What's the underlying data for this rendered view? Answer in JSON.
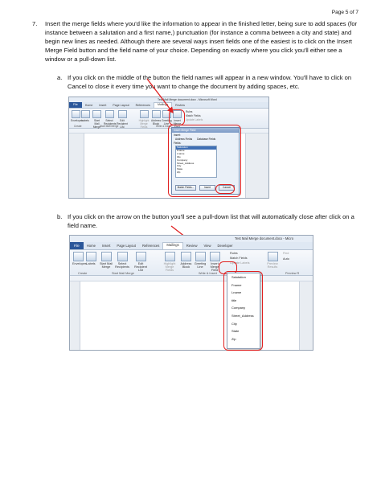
{
  "page_number": "Page 5 of 7",
  "step": {
    "number": "7.",
    "text": "Insert the merge fields where you'd like the information to appear in the finished letter, being sure to add spaces (for instance between a salutation and a first name,) punctuation (for instance a comma between a city and state) and begin new lines as needed.  Although there are several ways insert fields one of the easiest is to click on the Insert Merge Field button and the field name of your choice.  Depending on exactly where you click you'll either see a window or a pull-down list."
  },
  "sub_a": {
    "letter": "a.",
    "text": "If you click on the middle of the button the field names will appear in a new window.  You'll have to click on Cancel to close it every time you want to change the document by adding spaces, etc."
  },
  "sub_b": {
    "letter": "b.",
    "text": "If you click on the arrow on the button you'll see a pull-down list that will automatically close after click on a field name."
  },
  "shot1": {
    "title": "Test Mail Merge document.docx - Microsoft Word",
    "tabs": [
      "File",
      "Home",
      "Insert",
      "Page Layout",
      "References",
      "Mailings",
      "Review"
    ],
    "ribbon_buttons": [
      "Envelopes",
      "Labels",
      "Start Mail Merge",
      "Select Recipients",
      "Edit Recipient List",
      "Highlight Merge Fields",
      "Address Block",
      "Greeting Line",
      "Insert Merge Field"
    ],
    "right_buttons": [
      "Rules",
      "Match Fields",
      "Update Labels"
    ],
    "groups": [
      "Create",
      "Start Mail Merge",
      "Write & Insert"
    ],
    "dialog": {
      "title": "Insert Merge Field",
      "insert_label": "Insert:",
      "options": [
        "Address Fields",
        "Database Fields"
      ],
      "fields_label": "Fields:",
      "fields": [
        "Salutation",
        "Fname",
        "Lname",
        "title",
        "Company",
        "Street_Address",
        "City",
        "State",
        "Zip"
      ],
      "buttons": [
        "Match Fields...",
        "Insert",
        "Cancel"
      ]
    }
  },
  "shot2": {
    "title": "Test Mail Merge document.docx - Micro",
    "tabs": [
      "File",
      "Home",
      "Insert",
      "Page Layout",
      "References",
      "Mailings",
      "Review",
      "View",
      "Developer"
    ],
    "ribbon_buttons": [
      "Envelopes",
      "Labels",
      "Start Mail Merge",
      "Select Recipients",
      "Edit Recipient List",
      "Highlight Merge Fields",
      "Address Block",
      "Greeting Line",
      "Insert Merge Field"
    ],
    "right_buttons": [
      "Rules",
      "Match Fields",
      "Update Labels"
    ],
    "extra_buttons": [
      "Preview Results",
      "Find",
      "Auto"
    ],
    "groups": [
      "Create",
      "Start Mail Merge",
      "Write & Insert",
      "Preview R"
    ],
    "dropdown": [
      "Salutation",
      "Fname",
      "Lname",
      "title",
      "Company",
      "Street_Address",
      "City",
      "State",
      "Zip"
    ]
  }
}
